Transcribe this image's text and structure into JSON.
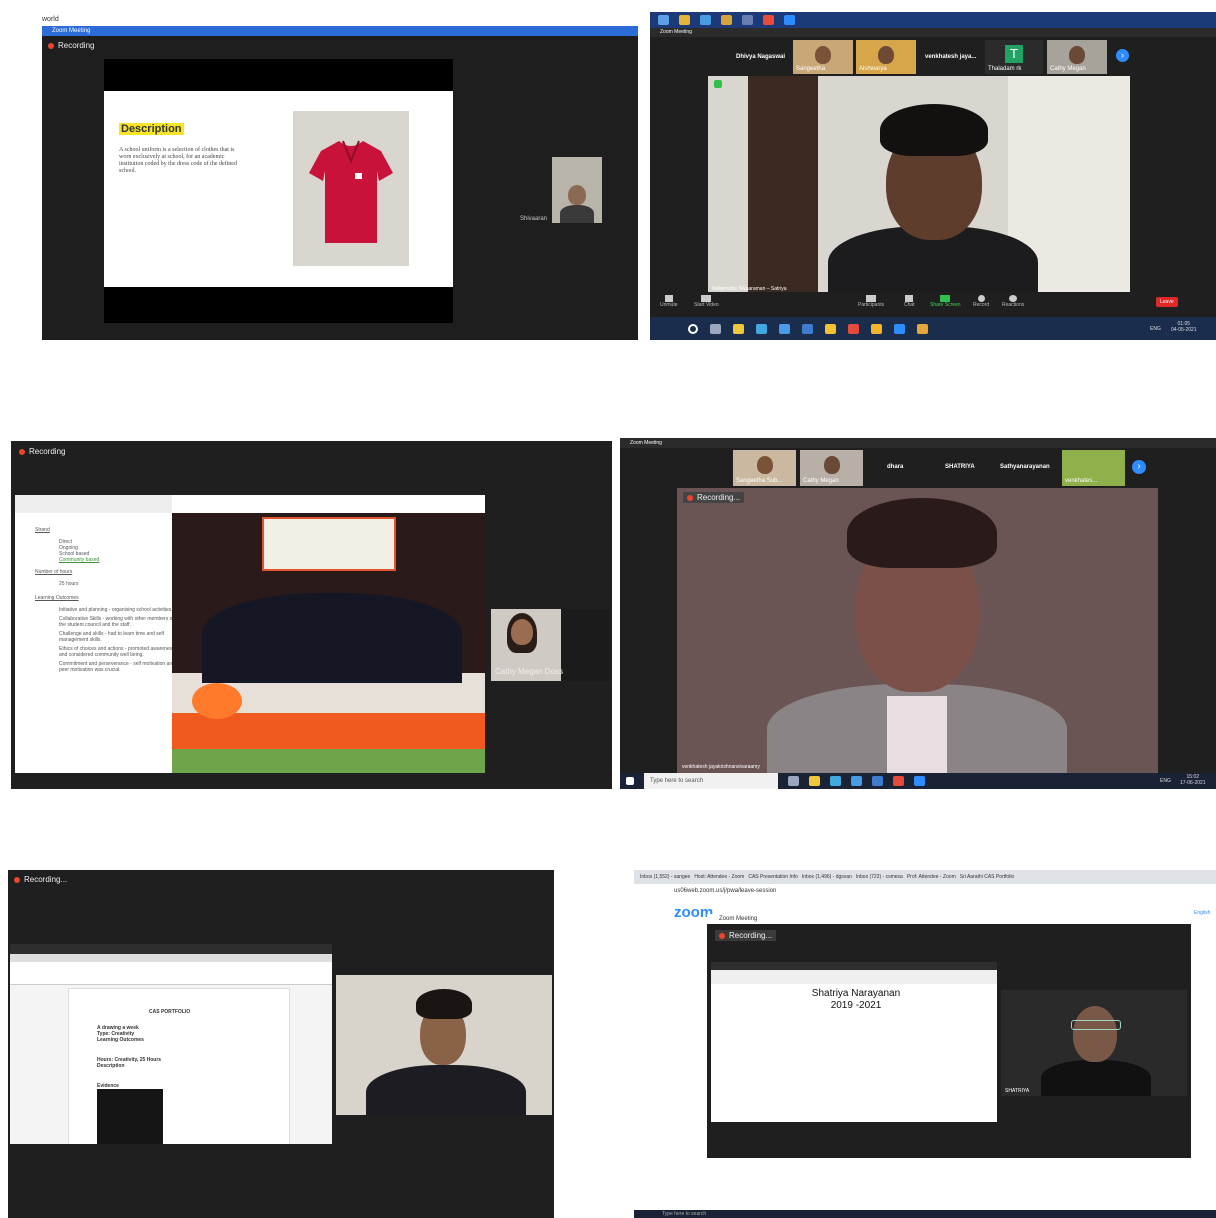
{
  "shot1": {
    "caption": "world",
    "window_title": "Zoom Meeting",
    "recording": "Recording",
    "slide_title": "Description",
    "slide_text": "A school uniform is a selection of clothes that is worn exclusively at school, for an academic institution coded by the dress code of the defined school.",
    "participant": "Shivaaran"
  },
  "shot2": {
    "window_title": "Zoom Meeting",
    "names": [
      "Dhivya Nagaswai",
      "Sangeetha",
      "Aishwarya",
      "venkhatesh jaya...",
      "T",
      "Thaladam rk",
      "Cathy Megan"
    ],
    "speaker": "Nallamuthu Sivaaraman – Satriya",
    "controls": [
      "Unmute",
      "Start Video",
      "Participants",
      "Chat",
      "Share Screen",
      "Record",
      "Reactions"
    ],
    "leave": "Leave",
    "tray_lang": "ENG",
    "time": "01:05",
    "date": "04-05-2021"
  },
  "shot3": {
    "recording": "Recording",
    "heading_strand": "Strand",
    "strand_items": [
      "Direct",
      "Ongoing",
      "School based",
      "Community based"
    ],
    "heading_hours": "Number of hours",
    "hours_items": [
      "25 hours"
    ],
    "heading_outcomes": "Learning Outcomes",
    "outcomes": [
      "Initiative and planning - organising school activities.",
      "Collaborative Skills - working with other members of the student council and the staff.",
      "Challenge and skills - had to learn time and self management skills.",
      "Ethics of choices and actions - promoted awareness and considered community well being.",
      "Commitment and perseverance - self motivation and peer motivation was crucial."
    ],
    "participant": "Cathy Megan Doss"
  },
  "shot4": {
    "window_title": "Zoom Meeting",
    "names": [
      "Sangeetha Sub...",
      "Cathy Megan",
      "dhara",
      "SHATRIYA",
      "Sathyanarayanan",
      "venkhates..."
    ],
    "recording": "Recording...",
    "speaker": "venkhatesh jayakrishnansivaraamy",
    "search": "Type here to search",
    "tray_lang": "ENG",
    "time": "15:02",
    "date": "17-06-2021"
  },
  "shot5": {
    "recording": "Recording...",
    "doc_title": "CAS PORTFOLIO",
    "doc_lines": [
      "A drawing a week",
      "Type: Creativity",
      "Learning Outcomes",
      "Hours: Creativity, 25 Hours",
      "Description",
      "Evidence"
    ]
  },
  "shot6": {
    "tabs": [
      "Inbox (1,552) - sangee",
      "Host: Attendee - Zoom",
      "CAS Presentation Info",
      "Inbox (1,496) - dgsvan",
      "Inbox (722) - csmesa",
      "Prof: Attendee - Zoom",
      "Sri Aarathi CAS Portfolio"
    ],
    "url": "us06web.zoom.us/j/pwa/leave-session",
    "logo": "zoom",
    "top_right": "English",
    "window_title": "Zoom Meeting",
    "recording": "Recording...",
    "doc_name": "Shatriya Narayanan",
    "doc_years": "2019 -2021",
    "participant": "SHATRIYA",
    "search": "Type here to search"
  }
}
